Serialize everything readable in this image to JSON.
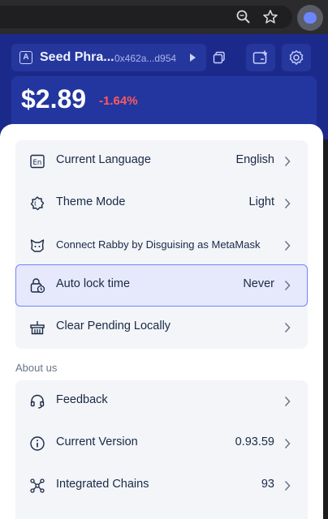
{
  "browser": {
    "zoom_icon": "zoom-icon",
    "bookmark_icon": "star-icon",
    "extension_icon": "rabby-extension-icon"
  },
  "wallet_header": {
    "account_name": "Seed Phra...",
    "account_address": "0x462a...d954",
    "balance": "$2.89",
    "change": "-1.64%",
    "colors": {
      "header_bg": "#1b2a8a",
      "change_red": "#ff5a5a"
    }
  },
  "settings": {
    "items": [
      {
        "label": "Current Language",
        "value": "English",
        "icon": "language-icon"
      },
      {
        "label": "Theme Mode",
        "value": "Light",
        "icon": "theme-icon"
      },
      {
        "label": "Connect Rabby by Disguising as MetaMask",
        "value": "",
        "icon": "metamask-icon"
      },
      {
        "label": "Auto lock time",
        "value": "Never",
        "icon": "lock-clock-icon",
        "selected": true
      },
      {
        "label": "Clear Pending Locally",
        "value": "",
        "icon": "clear-pending-icon"
      }
    ]
  },
  "about": {
    "title": "About us",
    "items": [
      {
        "label": "Feedback",
        "value": "",
        "icon": "headset-icon"
      },
      {
        "label": "Current Version",
        "value": "0.93.59",
        "icon": "info-icon"
      },
      {
        "label": "Integrated Chains",
        "value": "93",
        "icon": "chains-icon"
      }
    ]
  },
  "accent_color": "#7084ff"
}
